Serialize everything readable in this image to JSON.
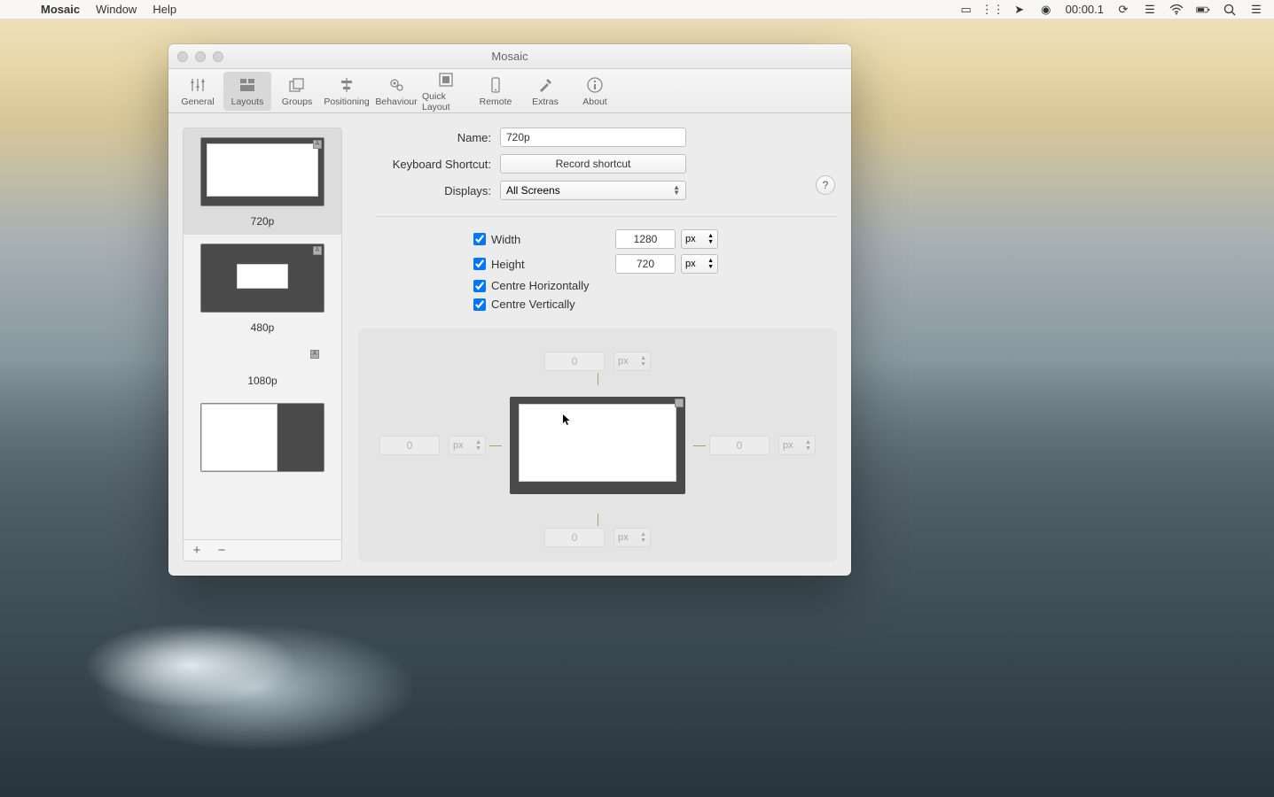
{
  "menubar": {
    "app": "Mosaic",
    "items": [
      "Window",
      "Help"
    ],
    "clock": "00:00.1"
  },
  "window": {
    "title": "Mosaic"
  },
  "toolbar": {
    "items": [
      {
        "id": "general",
        "label": "General"
      },
      {
        "id": "layouts",
        "label": "Layouts"
      },
      {
        "id": "groups",
        "label": "Groups"
      },
      {
        "id": "positioning",
        "label": "Positioning"
      },
      {
        "id": "behaviour",
        "label": "Behaviour"
      },
      {
        "id": "quicklayout",
        "label": "Quick Layout"
      },
      {
        "id": "remote",
        "label": "Remote"
      },
      {
        "id": "extras",
        "label": "Extras"
      },
      {
        "id": "about",
        "label": "About"
      }
    ],
    "active": "layouts"
  },
  "sidebar": {
    "items": [
      {
        "label": "720p"
      },
      {
        "label": "480p"
      },
      {
        "label": "1080p"
      },
      {
        "label": ""
      }
    ],
    "selected": 0
  },
  "form": {
    "name_label": "Name:",
    "name_value": "720p",
    "shortcut_label": "Keyboard Shortcut:",
    "shortcut_btn": "Record shortcut",
    "displays_label": "Displays:",
    "displays_value": "All Screens",
    "help": "?"
  },
  "dims": {
    "width_label": "Width",
    "width_checked": true,
    "width_value": "1280",
    "width_unit": "px",
    "height_label": "Height",
    "height_checked": true,
    "height_value": "720",
    "height_unit": "px",
    "centre_h_label": "Centre Horizontally",
    "centre_h_checked": true,
    "centre_v_label": "Centre Vertically",
    "centre_v_checked": true
  },
  "margins": {
    "top": "0",
    "top_unit": "px",
    "bottom": "0",
    "bottom_unit": "px",
    "left": "0",
    "left_unit": "px",
    "right": "0",
    "right_unit": "px"
  }
}
